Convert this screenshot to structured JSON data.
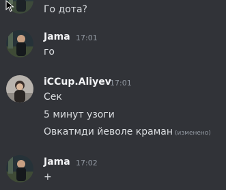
{
  "messages": [
    {
      "author": "",
      "time": "",
      "lines": [
        "Го дота?"
      ],
      "avatar_icon": "user-avatar-photo-dark"
    },
    {
      "author": "Jama",
      "time": "17:01",
      "lines": [
        "го"
      ],
      "avatar_icon": "user-avatar-photo-dark"
    },
    {
      "author": "iCCup.Aliyev",
      "time": "17:01",
      "lines": [
        "Сек",
        "5 минут узоги",
        "Овкатмди йеволе краман"
      ],
      "edited_label": "(изменено)",
      "avatar_icon": "user-avatar-photo-light"
    },
    {
      "author": "Jama",
      "time": "17:02",
      "lines": [
        "+"
      ],
      "avatar_icon": "user-avatar-photo-dark"
    }
  ],
  "colors": {
    "background": "#313338",
    "text": "#dbdee1",
    "author": "#f2f3f5",
    "muted": "#949ba4"
  }
}
